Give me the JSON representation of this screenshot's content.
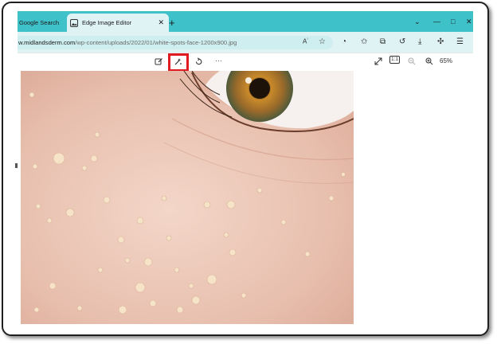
{
  "tabs": [
    {
      "label": "Google Search"
    },
    {
      "label": "Edge Image Editor"
    }
  ],
  "address_bar": {
    "url_domain": "w.midlandsderm.com",
    "url_path": "/wp-content/uploads/2022/01/white-spots-face-1200x900.jpg"
  },
  "toolbar": {
    "zoom_level": "65%",
    "actual_size_label": "1:1"
  },
  "icons": {
    "new_tab": "+",
    "minimize": "—",
    "maximize": "□",
    "close": "✕",
    "more": "…"
  },
  "colors": {
    "accent_teal": "#3fc1c9",
    "highlight_red": "#e11b22"
  }
}
